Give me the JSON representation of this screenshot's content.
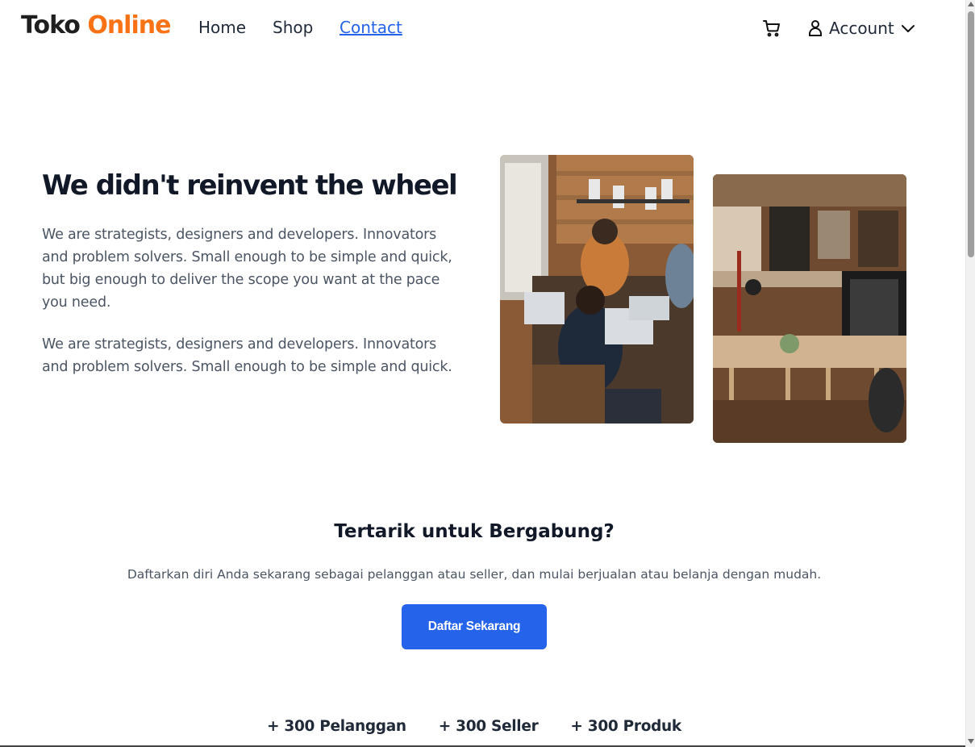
{
  "nav": {
    "logo_part1": "Toko",
    "logo_part2": "Online",
    "links": [
      {
        "label": "Home"
      },
      {
        "label": "Shop"
      },
      {
        "label": "Contact"
      }
    ],
    "account_label": "Account"
  },
  "hero": {
    "title": "We didn't reinvent the wheel",
    "paragraph1": "We are strategists, designers and developers. Innovators and problem solvers. Small enough to be simple and quick, but big enough to deliver the scope you want at the pace you need.",
    "paragraph2": "We are strategists, designers and developers. Innovators and problem solvers. Small enough to be simple and quick."
  },
  "cta": {
    "title": "Tertarik untuk Bergabung?",
    "text": "Daftarkan diri Anda sekarang sebagai pelanggan atau seller, dan mulai berjualan atau belanja dengan mudah.",
    "button_label": "Daftar Sekarang"
  },
  "stats": [
    {
      "label": "+ 300 Pelanggan"
    },
    {
      "label": "+ 300 Seller"
    },
    {
      "label": "+ 300 Produk"
    }
  ],
  "colors": {
    "brand_orange": "#f97316",
    "primary_blue": "#2563eb",
    "heading": "#111827",
    "body_text": "#4b5563"
  },
  "icons": [
    "cart-icon",
    "user-icon",
    "chevron-down-icon"
  ]
}
